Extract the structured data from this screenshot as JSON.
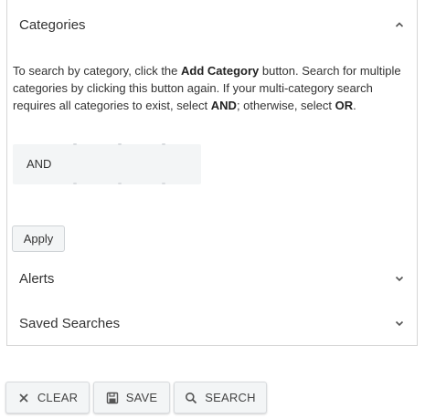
{
  "categories": {
    "title": "Categories",
    "expanded": true,
    "description_parts": [
      {
        "text": "To search by category, click the ",
        "bold": false
      },
      {
        "text": "Add Category",
        "bold": true
      },
      {
        "text": " button. Search for multiple categories by clicking this button again. If your multi-category search requires all categories to exist, select ",
        "bold": false
      },
      {
        "text": "AND",
        "bold": true
      },
      {
        "text": "; otherwise, select ",
        "bold": false
      },
      {
        "text": "OR",
        "bold": true
      },
      {
        "text": ".",
        "bold": false
      }
    ],
    "operator": "AND",
    "apply_label": "Apply"
  },
  "alerts": {
    "title": "Alerts",
    "expanded": false
  },
  "saved_searches": {
    "title": "Saved Searches",
    "expanded": false
  },
  "footer": {
    "clear_label": "CLEAR",
    "save_label": "SAVE",
    "search_label": "SEARCH"
  },
  "colors": {
    "text": "#333333",
    "border": "#d6d6d6",
    "button_bg": "#f3f5f6"
  }
}
